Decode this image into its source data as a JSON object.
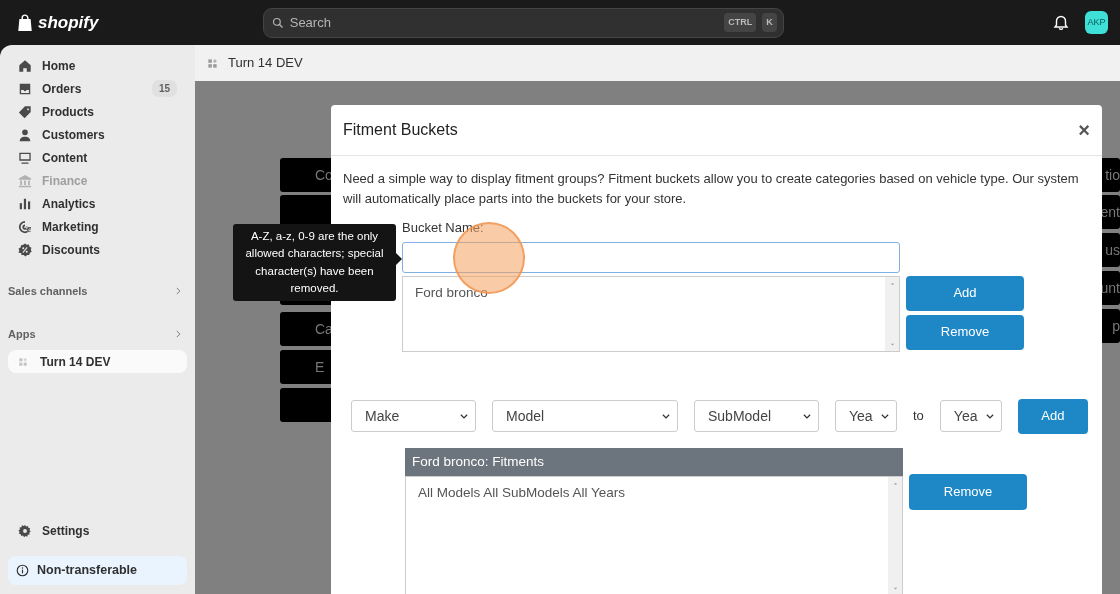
{
  "topbar": {
    "logo": "shopify",
    "search": {
      "placeholder": "Search",
      "keys": [
        "CTRL",
        "K"
      ]
    },
    "avatar": "AKP"
  },
  "sidebar": {
    "items": [
      {
        "label": "Home",
        "disabled": false
      },
      {
        "label": "Orders",
        "disabled": false,
        "count": "15"
      },
      {
        "label": "Products",
        "disabled": false
      },
      {
        "label": "Customers",
        "disabled": false
      },
      {
        "label": "Content",
        "disabled": false
      },
      {
        "label": "Finance",
        "disabled": true
      },
      {
        "label": "Analytics",
        "disabled": false
      },
      {
        "label": "Marketing",
        "disabled": false
      },
      {
        "label": "Discounts",
        "disabled": false
      }
    ],
    "sections": [
      {
        "label": "Sales channels"
      },
      {
        "label": "Apps"
      }
    ],
    "apps": [
      {
        "label": "Turn 14 DEV",
        "selected": true
      }
    ],
    "settings": "Settings",
    "notice": "Non-transferable"
  },
  "page_header": {
    "title": "Turn 14 DEV"
  },
  "background_buttons": {
    "left": [
      "Co",
      "Ca",
      "E"
    ],
    "right": [
      "tio",
      "ent",
      "us",
      "unt",
      "p"
    ]
  },
  "tooltip": "A-Z, a-z, 0-9 are the only allowed characters; special character(s) have been removed.",
  "modal": {
    "title": "Fitment Buckets",
    "close": "×",
    "description": "Need a simple way to display fitment groups? Fitment buckets allow you to create categories based on vehicle type. Our system will automatically place parts into the buckets for your store.",
    "bucket_label": "Bucket Name:",
    "bucket_items": [
      "Ford bronco"
    ],
    "bucket_buttons": [
      "Add",
      "Remove"
    ],
    "filters": [
      "Make",
      "Model",
      "SubModel",
      "Yea"
    ],
    "to_label": "to",
    "to_filter": "Yea",
    "filter_button": "Add",
    "fitments_title": "Ford bronco: Fitments",
    "fitments": [
      "All Models All SubModels All Years"
    ],
    "fitments_button": "Remove"
  }
}
